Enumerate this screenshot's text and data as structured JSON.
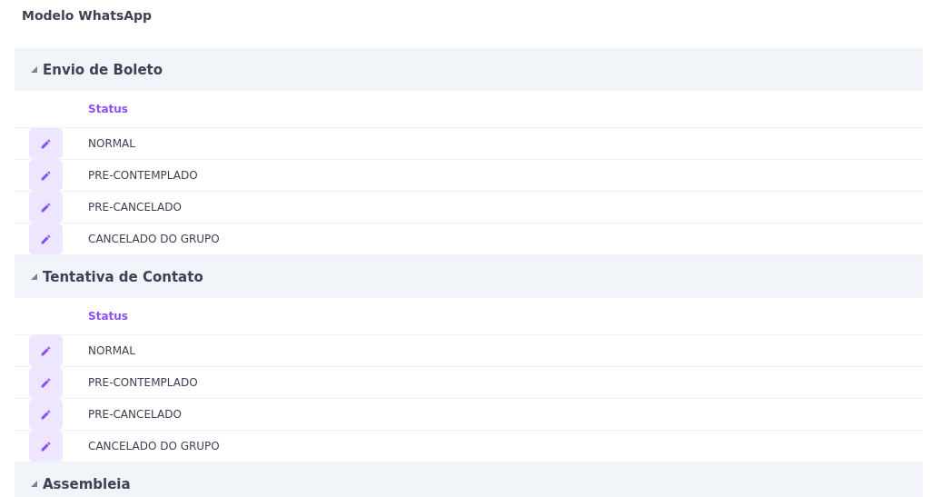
{
  "title": "Modelo WhatsApp",
  "groups": [
    {
      "name": "Envio de Boleto",
      "expanded": true,
      "column": "Status",
      "rows": [
        "NORMAL",
        "PRE-CONTEMPLADO",
        "PRE-CANCELADO",
        "CANCELADO DO GRUPO"
      ]
    },
    {
      "name": "Tentativa de Contato",
      "expanded": true,
      "column": "Status",
      "rows": [
        "NORMAL",
        "PRE-CONTEMPLADO",
        "PRE-CANCELADO",
        "CANCELADO DO GRUPO"
      ]
    },
    {
      "name": "Assembleia",
      "expanded": true
    }
  ]
}
